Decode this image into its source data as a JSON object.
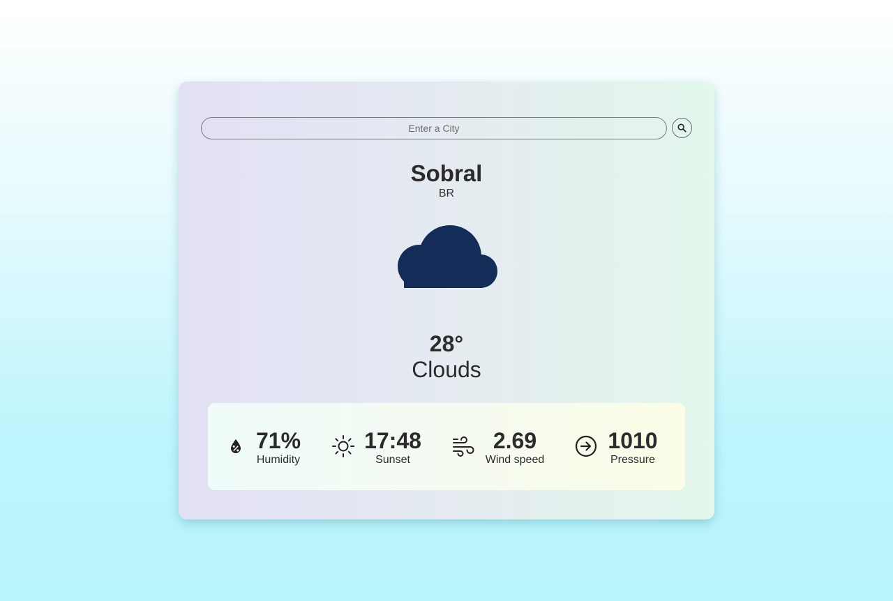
{
  "search": {
    "placeholder": "Enter a City",
    "button_icon": "search-icon"
  },
  "location": {
    "city": "Sobral",
    "country": "BR"
  },
  "weather": {
    "icon": "cloud-icon",
    "icon_color": "#132c58",
    "temperature": "28°",
    "condition": "Clouds"
  },
  "stats": [
    {
      "icon": "humidity-icon",
      "value": "71%",
      "label": "Humidity"
    },
    {
      "icon": "sun-icon",
      "value": "17:48",
      "label": "Sunset"
    },
    {
      "icon": "wind-icon",
      "value": "2.69",
      "label": "Wind speed"
    },
    {
      "icon": "arrow-circle-right-icon",
      "value": "1010",
      "label": "Pressure"
    }
  ]
}
